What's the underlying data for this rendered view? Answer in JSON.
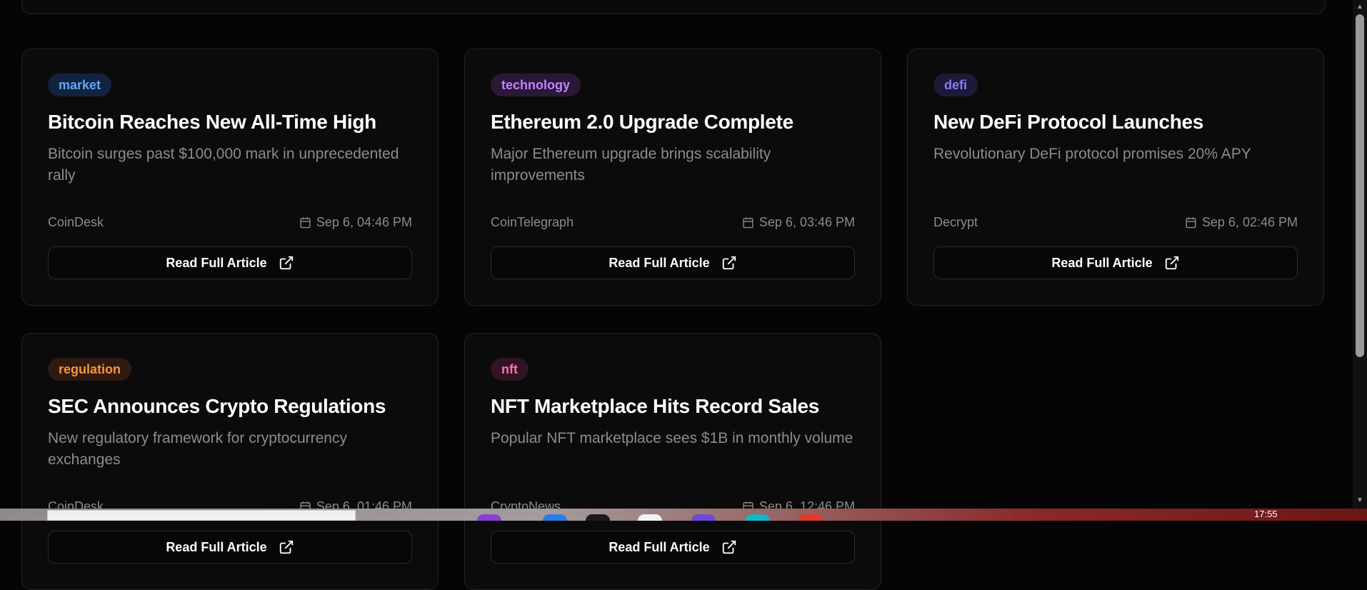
{
  "articles": [
    {
      "tag": "market",
      "tag_color": "#60a5fa",
      "tag_bg": "#13233f",
      "title": "Bitcoin Reaches New All-Time High",
      "description": "Bitcoin surges past $100,000 mark in unprecedented rally",
      "source": "CoinDesk",
      "date": "Sep 6, 04:46 PM",
      "button_label": "Read Full Article"
    },
    {
      "tag": "technology",
      "tag_color": "#c084fc",
      "tag_bg": "#2a1838",
      "title": "Ethereum 2.0 Upgrade Complete",
      "description": "Major Ethereum upgrade brings scalability improvements",
      "source": "CoinTelegraph",
      "date": "Sep 6, 03:46 PM",
      "button_label": "Read Full Article"
    },
    {
      "tag": "defi",
      "tag_color": "#8b7cf6",
      "tag_bg": "#1c1a38",
      "title": "New DeFi Protocol Launches",
      "description": "Revolutionary DeFi protocol promises 20% APY",
      "source": "Decrypt",
      "date": "Sep 6, 02:46 PM",
      "button_label": "Read Full Article"
    },
    {
      "tag": "regulation",
      "tag_color": "#fb923c",
      "tag_bg": "#2e1a10",
      "title": "SEC Announces Crypto Regulations",
      "description": "New regulatory framework for cryptocurrency exchanges",
      "source": "CoinDesk",
      "date": "Sep 6, 01:46 PM",
      "button_label": "Read Full Article"
    },
    {
      "tag": "nft",
      "tag_color": "#f472b6",
      "tag_bg": "#301421",
      "title": "NFT Marketplace Hits Record Sales",
      "description": "Popular NFT marketplace sees $1B in monthly volume",
      "source": "CryptoNews",
      "date": "Sep 6, 12:46 PM",
      "button_label": "Read Full Article"
    }
  ],
  "icons": {
    "calendar": "calendar-icon",
    "external_link": "external-link-icon"
  },
  "taskbar": {
    "clock": "17:55"
  }
}
